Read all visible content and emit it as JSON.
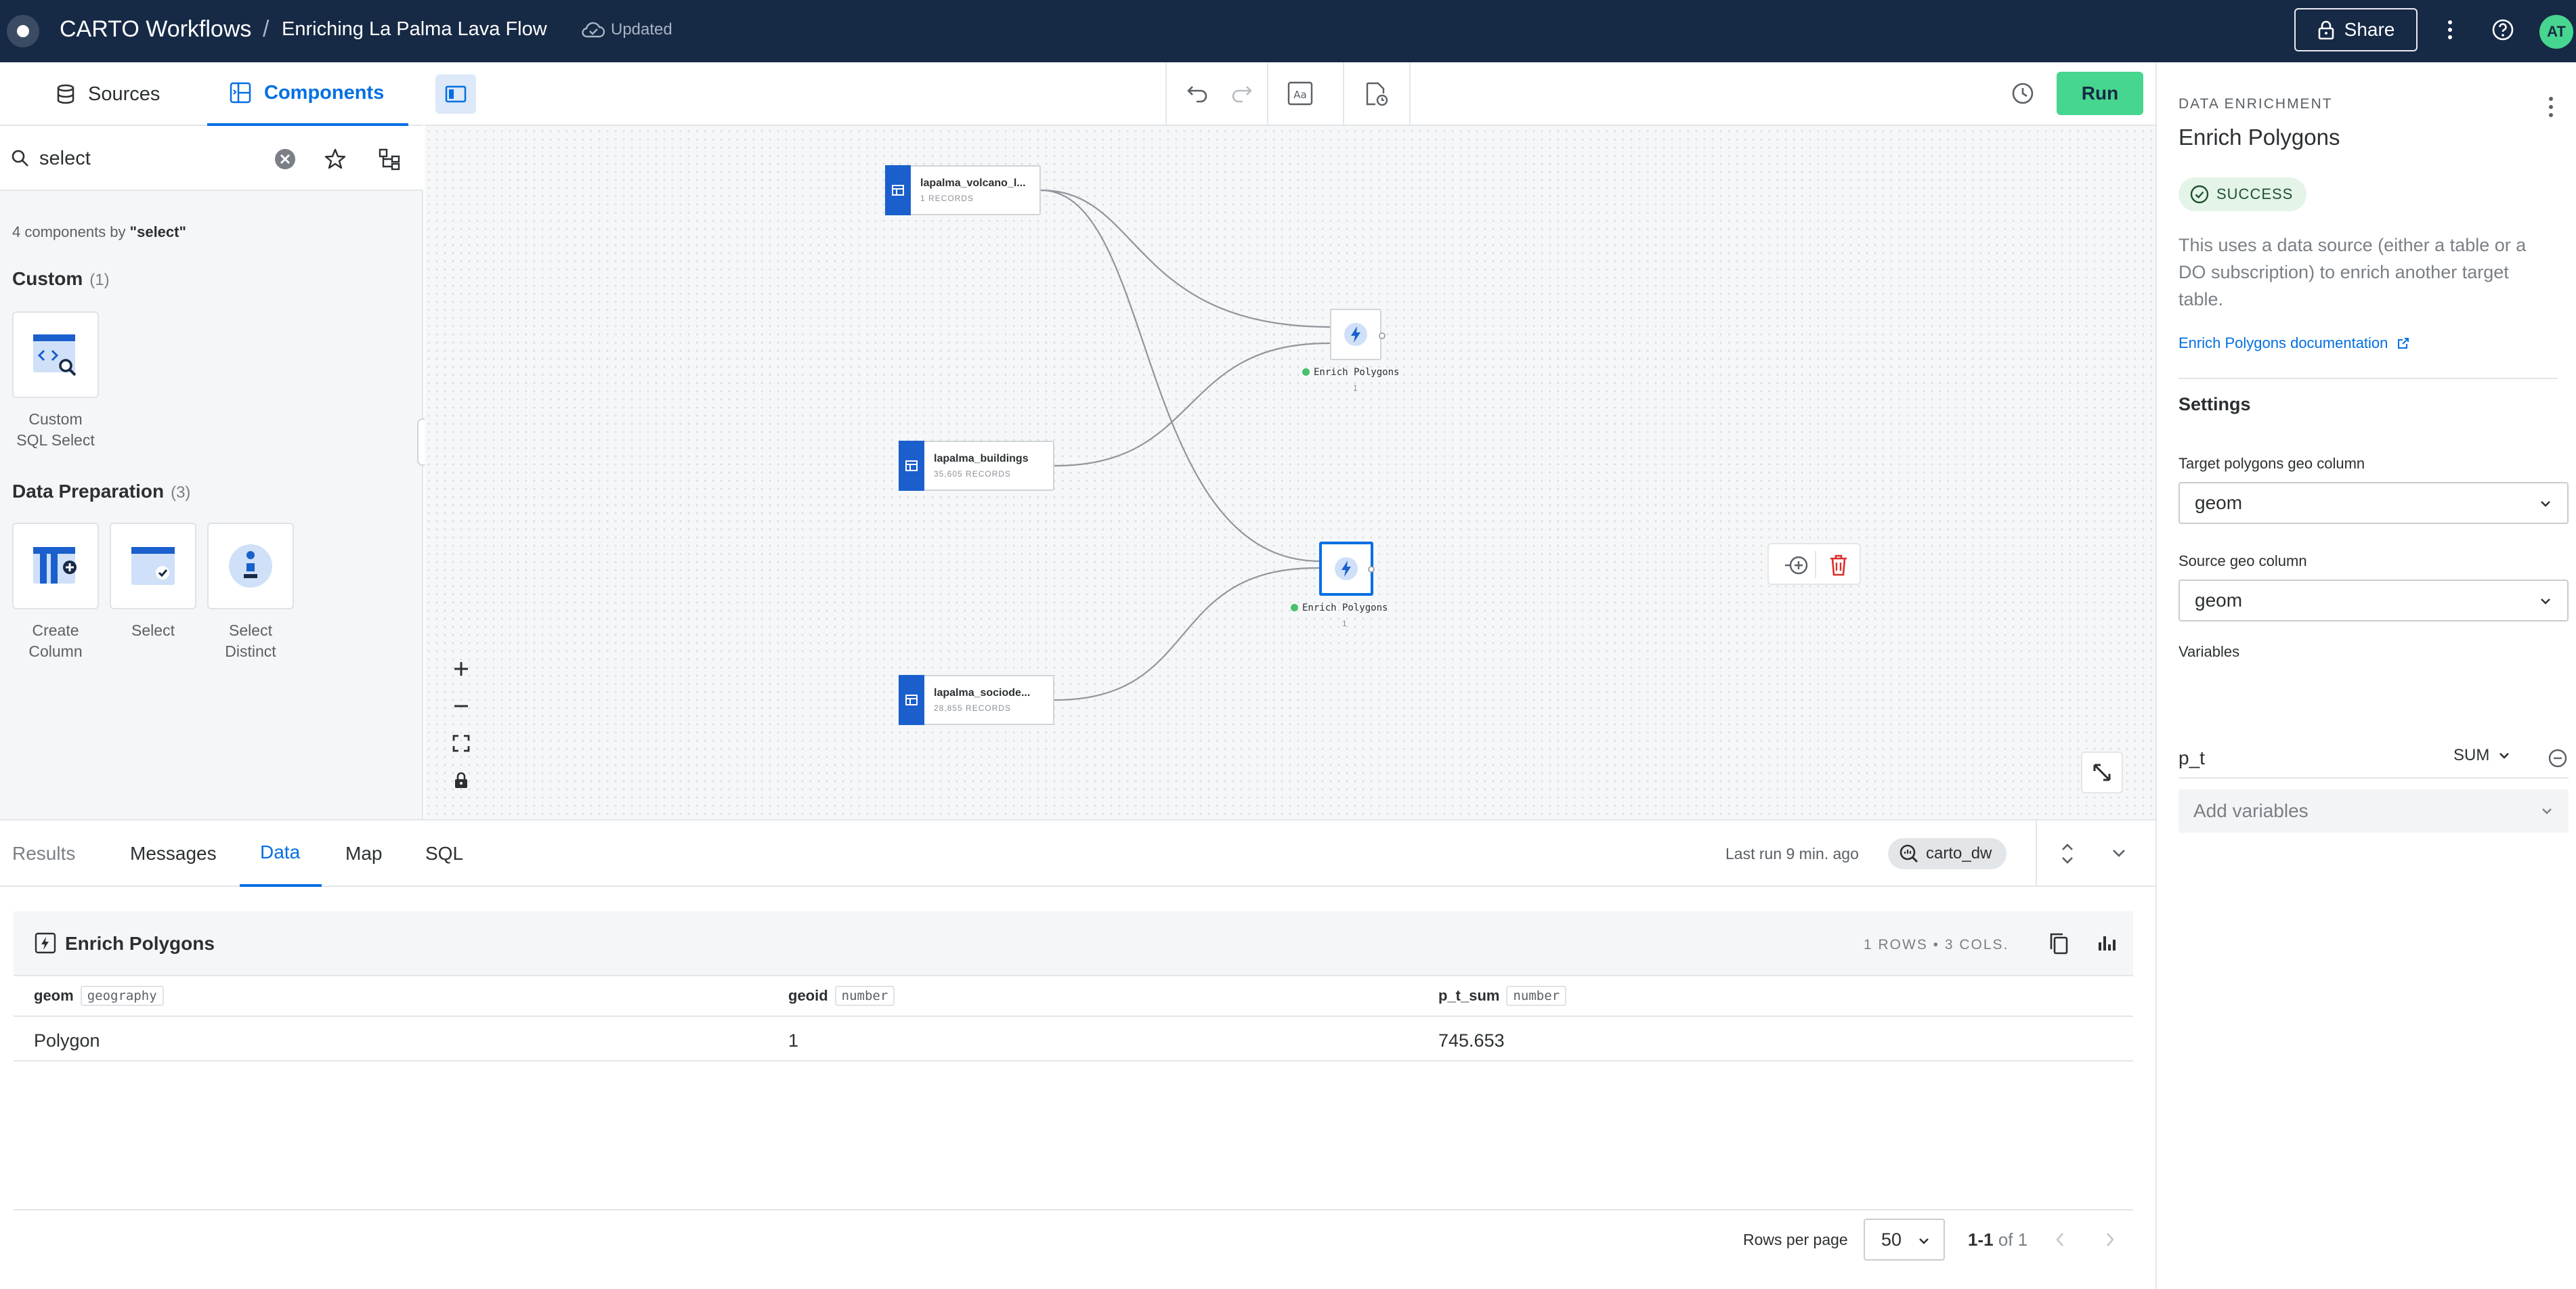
{
  "header": {
    "app_name": "CARTO Workflows",
    "separator": "/",
    "workflow_name": "Enriching La Palma Lava Flow",
    "save_status": "Updated",
    "share_label": "Share",
    "avatar_initials": "AT"
  },
  "left_panel": {
    "tabs": [
      {
        "label": "Sources",
        "icon": "database-icon"
      },
      {
        "label": "Components",
        "icon": "components-icon",
        "active": true
      }
    ],
    "search": {
      "value": "select"
    },
    "result_count_prefix": "4 components by ",
    "result_count_query": "\"select\"",
    "sections": [
      {
        "title": "Custom",
        "count": "(1)",
        "items": [
          {
            "line1": "Custom",
            "line2": "SQL Select",
            "icon": "custom-sql-icon"
          }
        ]
      },
      {
        "title": "Data Preparation",
        "count": "(3)",
        "items": [
          {
            "line1": "Create",
            "line2": "Column",
            "icon": "create-column-icon"
          },
          {
            "line1": "Select",
            "line2": "",
            "icon": "select-icon"
          },
          {
            "line1": "Select",
            "line2": "Distinct",
            "icon": "select-distinct-icon"
          }
        ]
      }
    ]
  },
  "canvas": {
    "run_label": "Run",
    "nodes": [
      {
        "title": "lapalma_volcano_l...",
        "subtitle": "1 RECORDS"
      },
      {
        "title": "lapalma_buildings",
        "subtitle": "35,605 RECORDS"
      },
      {
        "title": "lapalma_sociode...",
        "subtitle": "28,855 RECORDS"
      }
    ],
    "enrich_nodes": [
      {
        "label": "Enrich Polygons",
        "index": "1"
      },
      {
        "label": "Enrich Polygons",
        "index": "1"
      }
    ]
  },
  "right_panel": {
    "overline": "DATA ENRICHMENT",
    "title": "Enrich Polygons",
    "status": "SUCCESS",
    "description": "This uses a data source (either a table or a DO subscription) to enrich another target table.",
    "doc_link": "Enrich Polygons documentation",
    "settings_title": "Settings",
    "target_label": "Target polygons geo column",
    "target_value": "geom",
    "source_label": "Source geo column",
    "source_value": "geom",
    "variables_label": "Variables",
    "variable": {
      "name": "p_t",
      "aggregation": "SUM"
    },
    "add_variables_placeholder": "Add variables"
  },
  "bottom_panel": {
    "tabs": [
      {
        "label": "Results",
        "muted": true
      },
      {
        "label": "Messages"
      },
      {
        "label": "Data",
        "active": true
      },
      {
        "label": "Map"
      },
      {
        "label": "SQL"
      }
    ],
    "last_run": "Last run 9 min. ago",
    "connection": "carto_dw",
    "table": {
      "title": "Enrich Polygons",
      "meta": "1 ROWS • 3 COLS.",
      "columns": [
        {
          "name": "geom",
          "type": "geography"
        },
        {
          "name": "geoid",
          "type": "number"
        },
        {
          "name": "p_t_sum",
          "type": "number"
        }
      ],
      "rows": [
        [
          "Polygon",
          "1",
          "745.653"
        ]
      ]
    },
    "pagination": {
      "rows_per_page_label": "Rows per page",
      "rows_per_page": "50",
      "range": "1-1",
      "of_total": "of 1"
    }
  }
}
